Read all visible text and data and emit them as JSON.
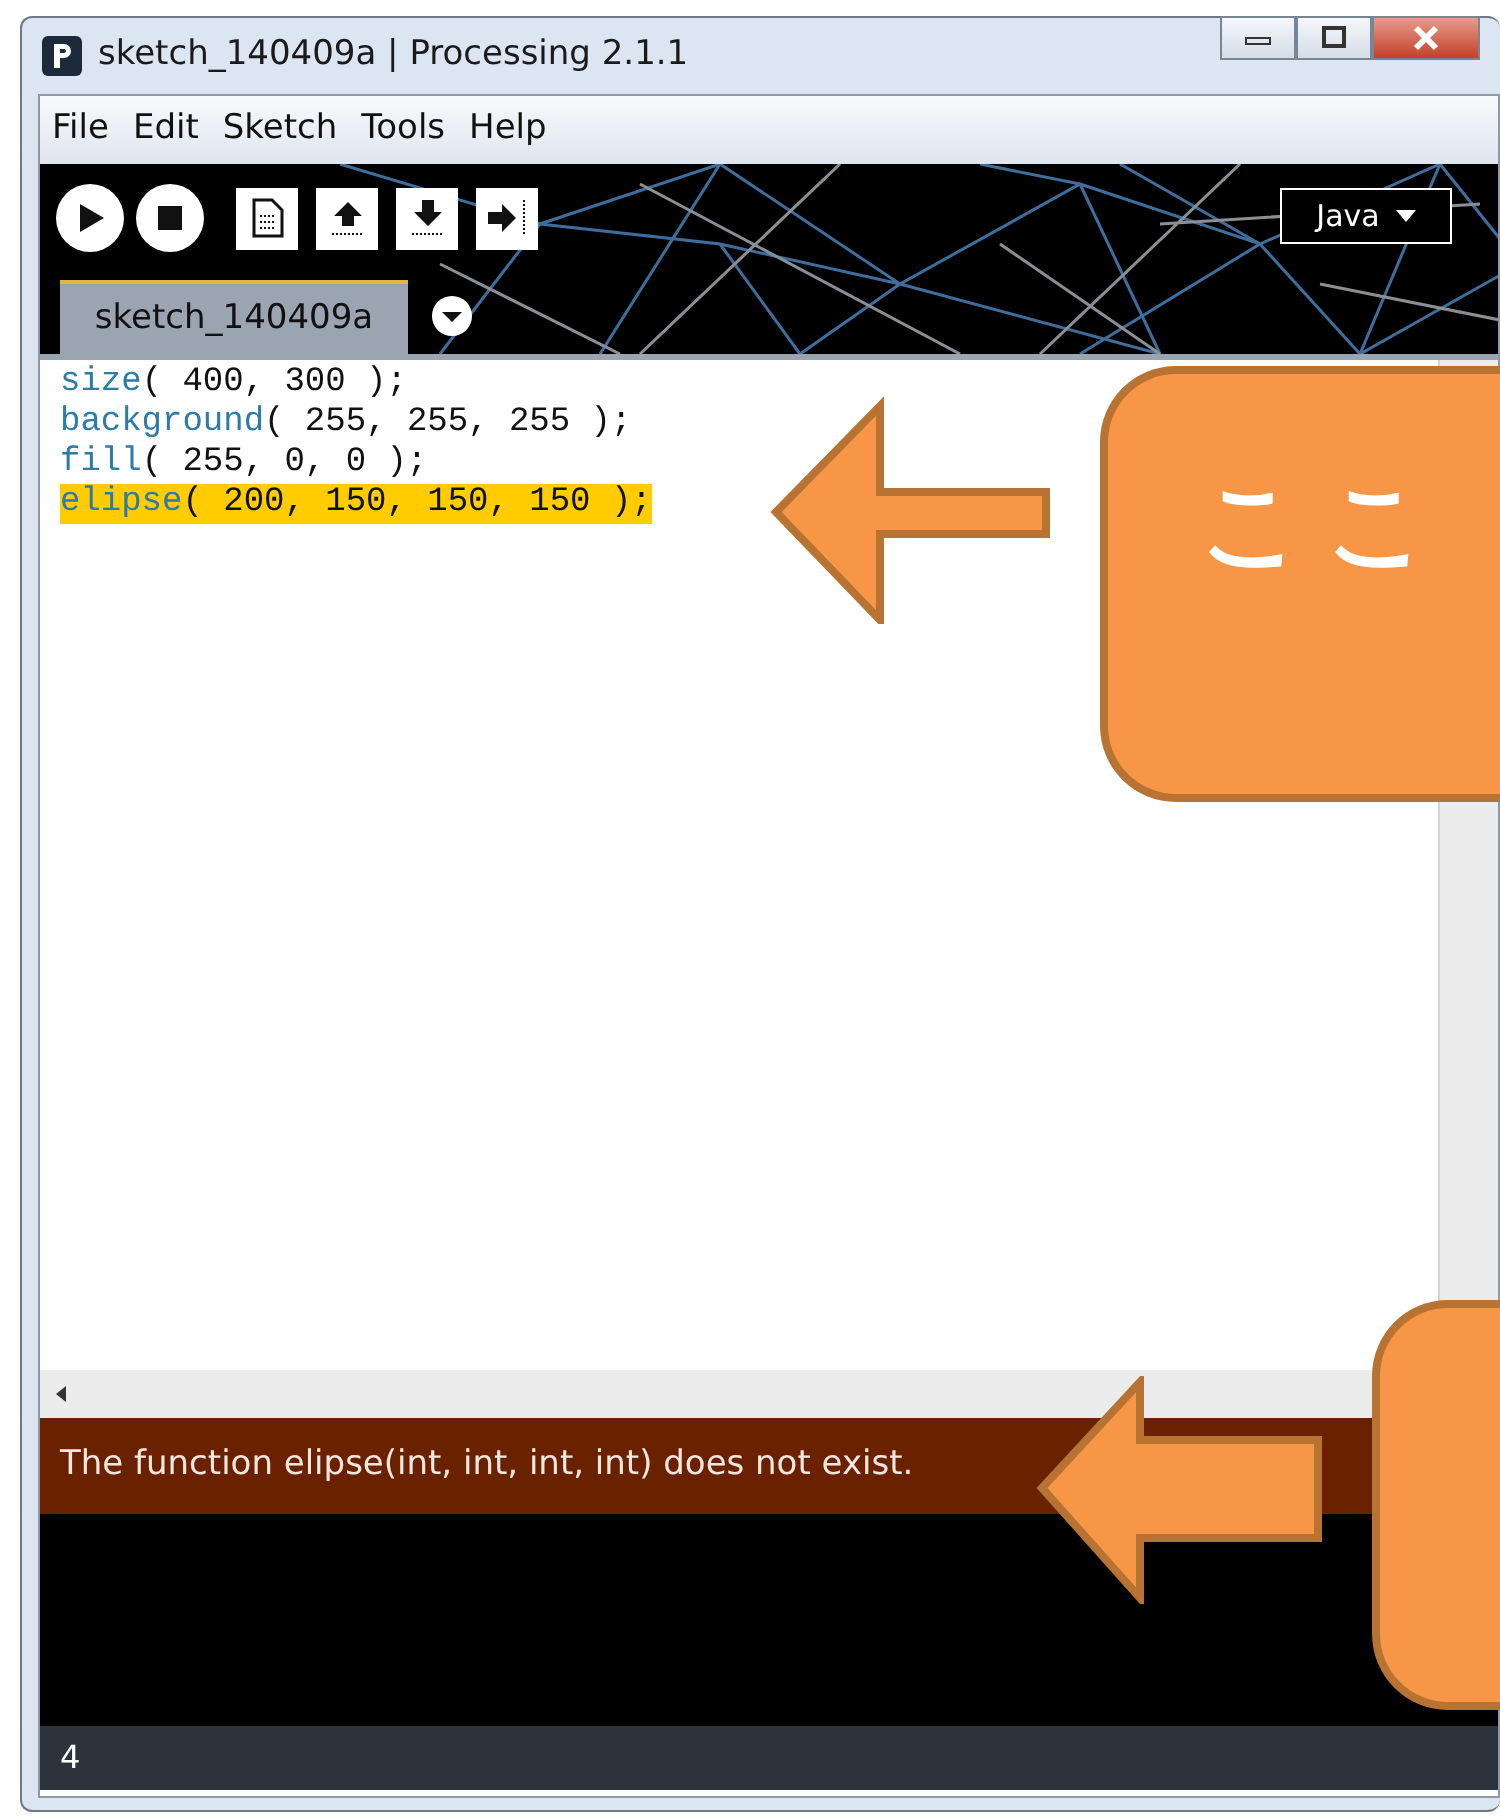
{
  "window": {
    "title": "sketch_140409a | Processing 2.1.1"
  },
  "menu": [
    "File",
    "Edit",
    "Sketch",
    "Tools",
    "Help"
  ],
  "toolbar": {
    "mode": "Java"
  },
  "tabs": [
    {
      "label": "sketch_140409a",
      "selected": true
    }
  ],
  "code": [
    {
      "function": "size",
      "args": "( 400, 300 );",
      "highlighted": false
    },
    {
      "function": "background",
      "args": "( 255, 255, 255 );",
      "highlighted": false
    },
    {
      "function": "fill",
      "args": "( 255, 0, 0 );",
      "highlighted": false
    },
    {
      "function": "elipse",
      "args": "( 200, 150, 150, 150 );",
      "highlighted": true
    }
  ],
  "error_message": "The function elipse(int, int, int, int) does not exist.",
  "status_bar": "4",
  "callouts": [
    {
      "text": "ここ"
    }
  ]
}
